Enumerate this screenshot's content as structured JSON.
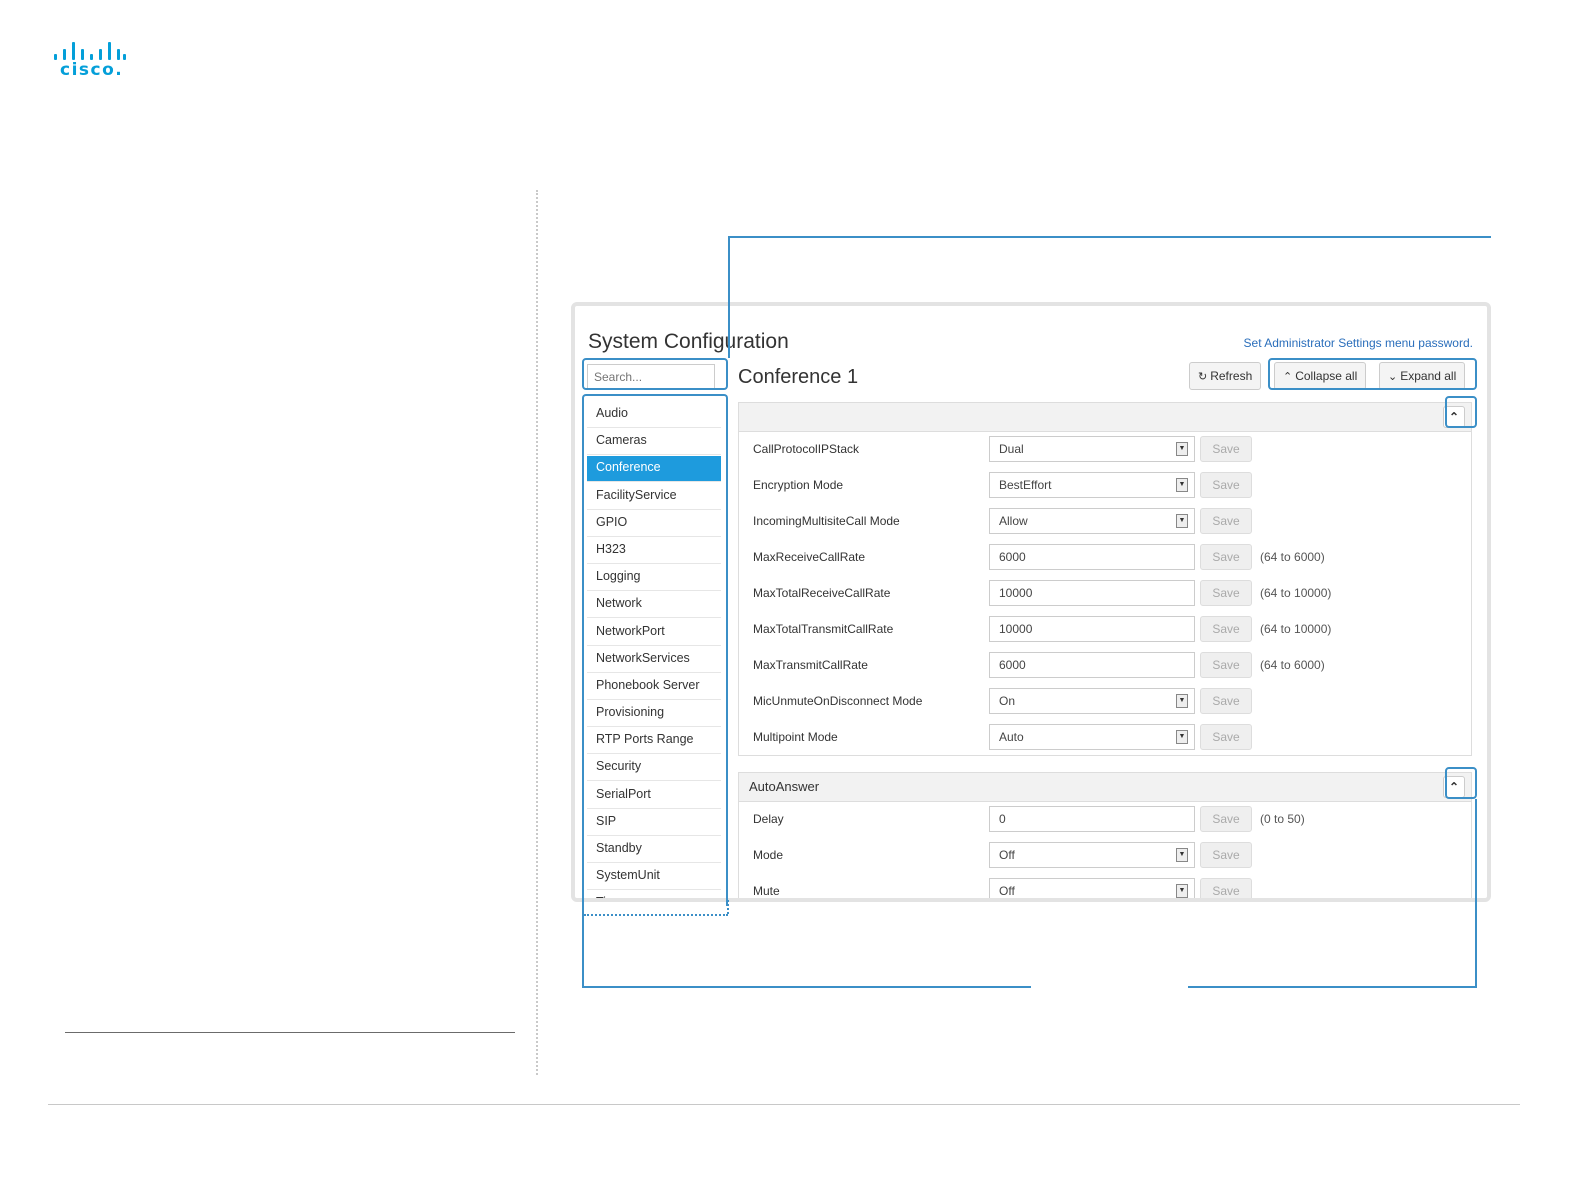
{
  "logo": {
    "text": "cisco.",
    "brand_color": "#049fd9"
  },
  "header": {
    "title": "System Configuration",
    "admin_link": "Set Administrator Settings menu password."
  },
  "search": {
    "placeholder": "Search..."
  },
  "sidebar": {
    "active_color": "#1e9bdd",
    "items": [
      {
        "label": "Audio"
      },
      {
        "label": "Cameras"
      },
      {
        "label": "Conference",
        "active": true
      },
      {
        "label": "FacilityService"
      },
      {
        "label": "GPIO"
      },
      {
        "label": "H323"
      },
      {
        "label": "Logging"
      },
      {
        "label": "Network"
      },
      {
        "label": "NetworkPort"
      },
      {
        "label": "NetworkServices"
      },
      {
        "label": "Phonebook Server"
      },
      {
        "label": "Provisioning"
      },
      {
        "label": "RTP Ports Range"
      },
      {
        "label": "Security"
      },
      {
        "label": "SerialPort"
      },
      {
        "label": "SIP"
      },
      {
        "label": "Standby"
      },
      {
        "label": "SystemUnit"
      },
      {
        "label": "Time"
      }
    ]
  },
  "section": {
    "title": "Conference 1"
  },
  "toolbar": {
    "refresh_label": "Refresh",
    "refresh_icon": "refresh-icon",
    "collapse_all_label": "Collapse all",
    "collapse_icon": "chevron-up-icon",
    "expand_all_label": "Expand all",
    "expand_icon": "chevron-down-icon"
  },
  "save_label": "Save",
  "general_panel": {
    "title": "",
    "rows": [
      {
        "label": "CallProtocolIPStack",
        "value": "Dual",
        "type": "select"
      },
      {
        "label": "Encryption Mode",
        "value": "BestEffort",
        "type": "select"
      },
      {
        "label": "IncomingMultisiteCall Mode",
        "value": "Allow",
        "type": "select"
      },
      {
        "label": "MaxReceiveCallRate",
        "value": "6000",
        "type": "text",
        "range": "(64 to 6000)"
      },
      {
        "label": "MaxTotalReceiveCallRate",
        "value": "10000",
        "type": "text",
        "range": "(64 to 10000)"
      },
      {
        "label": "MaxTotalTransmitCallRate",
        "value": "10000",
        "type": "text",
        "range": "(64 to 10000)"
      },
      {
        "label": "MaxTransmitCallRate",
        "value": "6000",
        "type": "text",
        "range": "(64 to 6000)"
      },
      {
        "label": "MicUnmuteOnDisconnect Mode",
        "value": "On",
        "type": "select"
      },
      {
        "label": "Multipoint Mode",
        "value": "Auto",
        "type": "select"
      }
    ]
  },
  "autoanswer_panel": {
    "title": "AutoAnswer",
    "rows": [
      {
        "label": "Delay",
        "value": "0",
        "type": "text",
        "range": "(0 to 50)"
      },
      {
        "label": "Mode",
        "value": "Off",
        "type": "select"
      },
      {
        "label": "Mute",
        "value": "Off",
        "type": "select"
      }
    ]
  },
  "highlight_color": "#3b8fc7"
}
